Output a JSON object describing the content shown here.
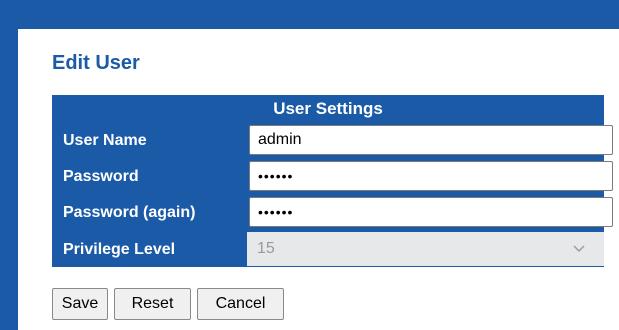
{
  "page": {
    "title": "Edit User"
  },
  "table": {
    "header": "User Settings",
    "rows": [
      {
        "label": "User Name",
        "value": "admin"
      },
      {
        "label": "Password",
        "value": "••••••"
      },
      {
        "label": "Password (again)",
        "value": "••••••"
      }
    ],
    "privilege": {
      "label": "Privilege Level",
      "selected": "15",
      "icon": "chevron-down-icon",
      "disabled": true
    }
  },
  "buttons": {
    "save": "Save",
    "reset": "Reset",
    "cancel": "Cancel"
  },
  "colors": {
    "brand_blue": "#1a5aa6",
    "disabled_bg": "#e6e8ea",
    "disabled_text": "#9a9a9a"
  }
}
